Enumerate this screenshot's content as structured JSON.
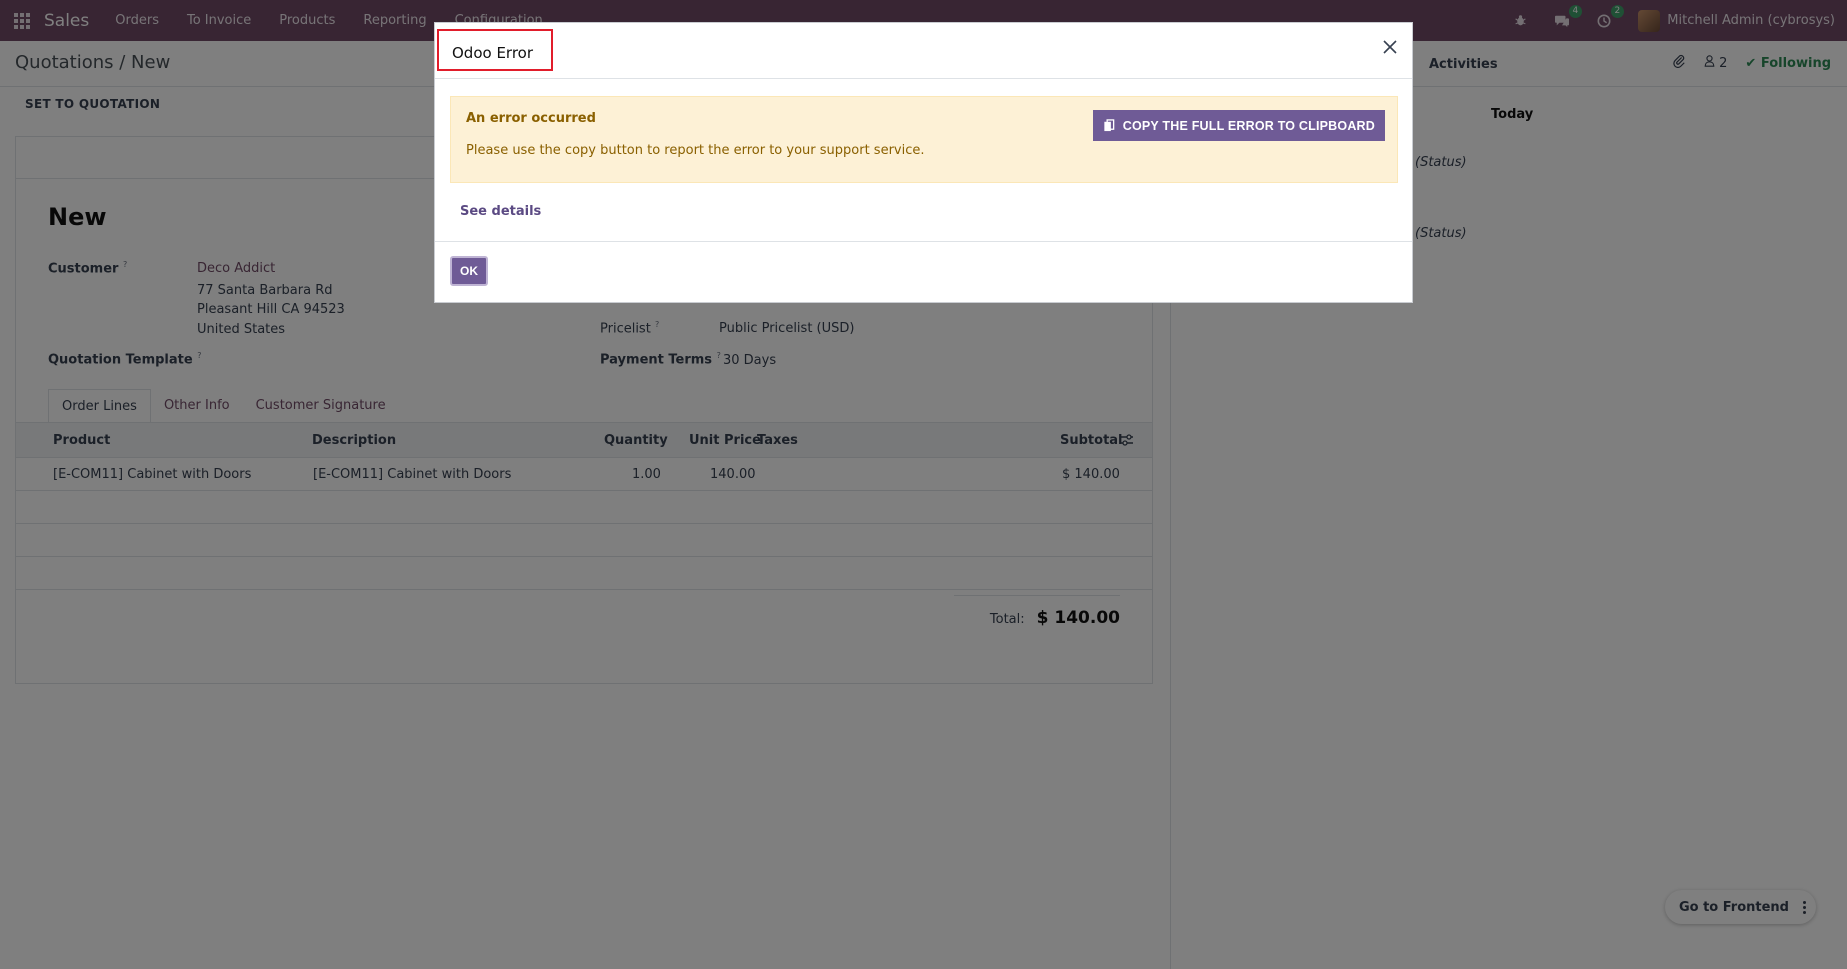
{
  "navbar": {
    "brand": "Sales",
    "menu": [
      "Orders",
      "To Invoice",
      "Products",
      "Reporting",
      "Configuration"
    ],
    "messages_count": "4",
    "activities_count": "2",
    "user": "Mitchell Admin (cybrosys)"
  },
  "control_panel": {
    "breadcrumb": "Quotations / New",
    "status_button": "SET TO QUOTATION",
    "activities_label": "Activities",
    "followers_count": "2",
    "following_label": "Following"
  },
  "chatter": {
    "today": "Today",
    "status_1": "(Status)",
    "status_2": "(Status)"
  },
  "form": {
    "title": "New",
    "customer_label": "Customer",
    "customer_name": "Deco Addict",
    "address_line1": "77 Santa Barbara Rd",
    "address_line2": "Pleasant Hill CA 94523",
    "address_line3": "United States",
    "template_label": "Quotation Template",
    "pricelist_label": "Pricelist",
    "pricelist_value": "Public Pricelist (USD)",
    "payment_label": "Payment Terms",
    "payment_value": "30 Days",
    "help_mark": "?",
    "tabs": [
      "Order Lines",
      "Other Info",
      "Customer Signature"
    ],
    "columns": {
      "product": "Product",
      "description": "Description",
      "quantity": "Quantity",
      "unit_price": "Unit Price",
      "taxes": "Taxes",
      "subtotal": "Subtotal"
    },
    "lines": [
      {
        "product": "[E-COM11] Cabinet with Doors",
        "description": "[E-COM11] Cabinet with Doors",
        "quantity": "1.00",
        "unit_price": "140.00",
        "taxes": "",
        "subtotal": "$ 140.00"
      }
    ],
    "total_label": "Total:",
    "total_value": "$ 140.00"
  },
  "dialog": {
    "title": "Odoo Error",
    "alert_title": "An error occurred",
    "alert_text": "Please use the copy button to report the error to your support service.",
    "copy_button": "COPY THE FULL ERROR TO CLIPBOARD",
    "see_details": "See details",
    "ok_button": "OK"
  },
  "frontend_button": "Go to Frontend",
  "colors": {
    "brand": "#714b67",
    "primary_button": "#6f5b96",
    "warning_bg": "#fdf1d6",
    "highlight_border": "#e11d2b",
    "following": "#2e8b57"
  }
}
